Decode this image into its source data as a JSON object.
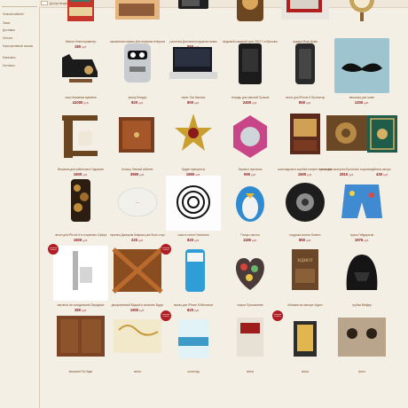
{
  "sidebar": {
    "items": [
      {
        "label": "Личный кабинет"
      },
      {
        "label": "Заказ"
      },
      {
        "label": "Доставка"
      },
      {
        "label": "Оплата"
      },
      {
        "label": "Корпоративные заказы"
      },
      {
        "label": "Магазины"
      },
      {
        "label": "Контакты"
      }
    ]
  },
  "header": {
    "links": [
      "Доступ вещей"
    ]
  },
  "products": [
    {
      "title": "Магнит Книги правитер",
      "price": "180",
      "img": "book-red"
    },
    {
      "title": "шахматная книжка Для перерыв генерального Вирд",
      "price": "520",
      "img": "book-collage"
    },
    {
      "title": "расческа Для многостружная ножик",
      "price": "850",
      "img": "phone-black"
    },
    {
      "title": "ведомый кожаный хрон 300-Г1 и бутылка",
      "price": "8480",
      "img": "flask-brown"
    },
    {
      "title": "пружка Йорк Дома",
      "price": "970",
      "img": "shelf-red"
    },
    {
      "title": "стул Кирбов",
      "price": "14100",
      "img": "dome-antique"
    },
    {
      "title": "часы Машинка времени",
      "price": "41000",
      "img": "sewing"
    },
    {
      "title": "флягу Бендер",
      "price": "920",
      "img": "robot-flask"
    },
    {
      "title": "пакет Лос Мьюзик",
      "price": "800",
      "img": "box-puzzle"
    },
    {
      "title": "тетрадь для записей Лучшие",
      "price": "2400",
      "img": "case-black"
    },
    {
      "title": "чехол для iPhone 5 Протектор",
      "price": "850",
      "img": "phone-case"
    },
    {
      "title": "вешалка для шляп",
      "price": "1200",
      "img": "mustache"
    },
    {
      "title": "Вешалка для кабельных Подписан",
      "price": "1600",
      "img": "coffee-stand"
    },
    {
      "title": "Кольцо Личный кабинет",
      "price": "3590",
      "img": "wood-box"
    },
    {
      "title": "Орден принцессы",
      "price": "1690",
      "img": "star-medal"
    },
    {
      "title": "Зеркало прическа",
      "price": "590",
      "img": "mirror-frame"
    },
    {
      "title": "шоколадная в коробке конфет в упаковке",
      "price": "1600",
      "img": "chocolate"
    },
    {
      "title": "чехол для шкатулки Булочные сокровища",
      "price": "2810",
      "img": "gear-book"
    },
    {
      "title": "Книга-шпора",
      "price": "430",
      "img": "book-green"
    },
    {
      "title": "чехол для iPhone 5 в сохраниях Сфера",
      "price": "1600",
      "img": "phone-gold"
    },
    {
      "title": "тарелка Дискусия Коврика уже быть сторожит",
      "price": "220",
      "img": "plate-red"
    },
    {
      "title": "часы в стиле Гипнотика",
      "price": "820",
      "img": "hypno-clock"
    },
    {
      "title": "Птица счастья",
      "price": "1180",
      "img": "penguin"
    },
    {
      "title": "подушка колесо Бизнес",
      "price": "850",
      "img": "tire"
    },
    {
      "title": "трусы Гейдарогия",
      "price": "1976",
      "img": "shorts"
    },
    {
      "title": "магниты на холодильник Парадные",
      "price": "380",
      "img": "fridge-magnet"
    },
    {
      "title": "декоративный Вадзой и качество Вдруг",
      "price": "1900",
      "img": "wood-cross"
    },
    {
      "title": "пазлы для iPhone 5 Вёсичные",
      "price": "820",
      "img": "phone-blue"
    },
    {
      "title": "серьги Пуссикативе",
      "price": "",
      "img": "heart-buttons"
    },
    {
      "title": "обложка на паспорт Идиот",
      "price": "",
      "img": "book-idiot"
    },
    {
      "title": "трубка Вейдер",
      "price": "",
      "img": "vader"
    },
    {
      "title": "вешалка Пи-Лиде",
      "price": "",
      "img": "wood-door"
    },
    {
      "title": "книга",
      "price": "",
      "img": "map-scratch"
    },
    {
      "title": "шоколад",
      "price": "",
      "img": "milk-carton"
    },
    {
      "title": "книга",
      "price": "",
      "img": "book-vintage"
    },
    {
      "title": "книга",
      "price": "",
      "img": "lamp-book"
    },
    {
      "title": "фото",
      "price": "",
      "img": "photo-vintage"
    }
  ],
  "badges": {
    "new_label": "новинки сезона"
  }
}
